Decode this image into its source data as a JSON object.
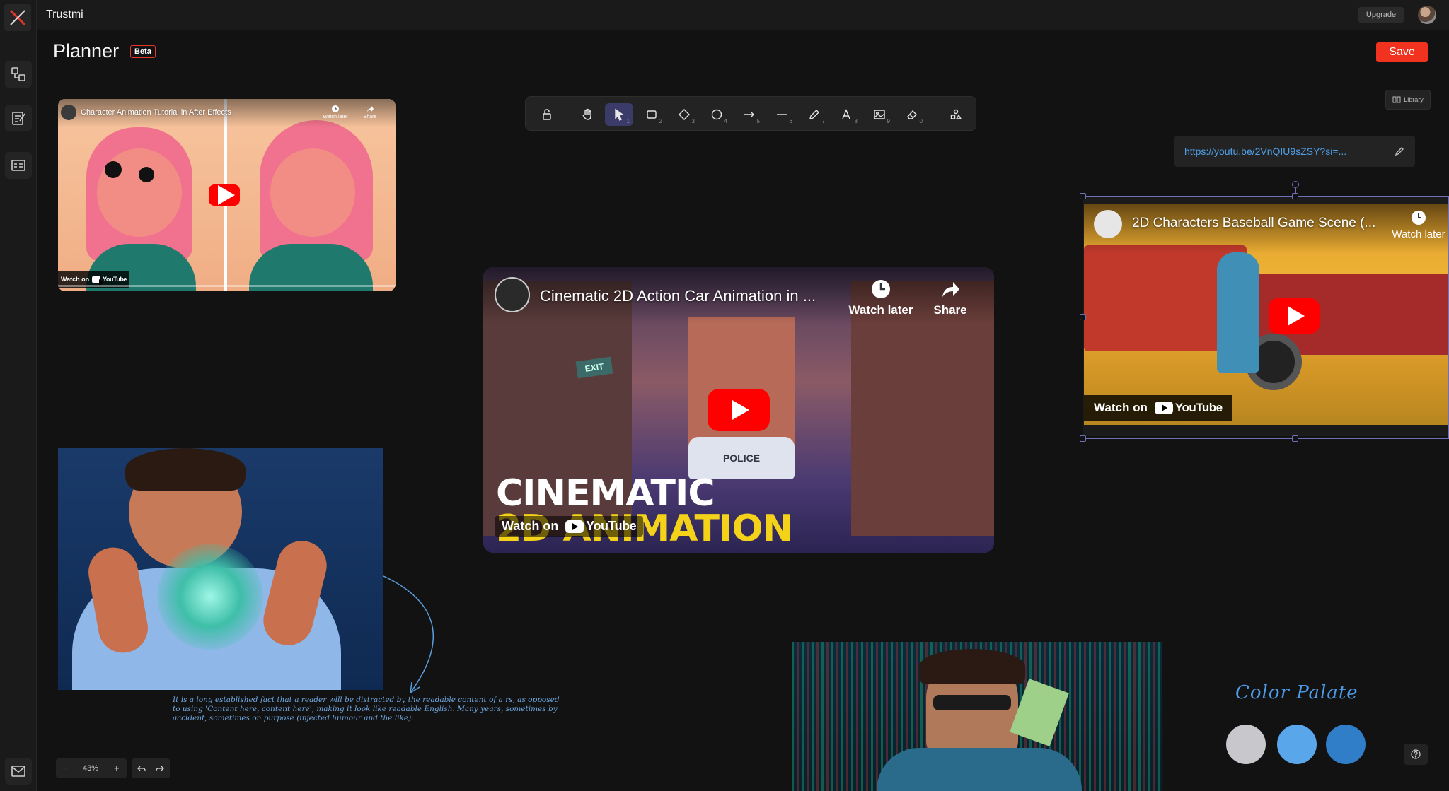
{
  "app": {
    "name": "Trustmi",
    "upgrade_label": "Upgrade"
  },
  "sidebar": {
    "items": [
      {
        "icon": "flow-icon"
      },
      {
        "icon": "notes-icon"
      },
      {
        "icon": "board-icon"
      },
      {
        "icon": "mail-icon"
      }
    ]
  },
  "header": {
    "title": "Planner",
    "badge": "Beta",
    "save_label": "Save"
  },
  "toolbar": {
    "tools": [
      {
        "icon": "lock-icon",
        "num": ""
      },
      {
        "icon": "hand-icon",
        "num": ""
      },
      {
        "icon": "pointer-icon",
        "num": "1",
        "active": true
      },
      {
        "icon": "rectangle-icon",
        "num": "2"
      },
      {
        "icon": "diamond-icon",
        "num": "3"
      },
      {
        "icon": "circle-icon",
        "num": "4"
      },
      {
        "icon": "arrow-icon",
        "num": "5"
      },
      {
        "icon": "line-icon",
        "num": "6"
      },
      {
        "icon": "pencil-icon",
        "num": "7"
      },
      {
        "icon": "text-icon",
        "num": "8"
      },
      {
        "icon": "image-icon",
        "num": "9"
      },
      {
        "icon": "eraser-icon",
        "num": "0"
      },
      {
        "icon": "shapes-icon",
        "num": ""
      }
    ]
  },
  "library_label": "Library",
  "url_bar": {
    "value": "https://youtu.be/2VnQIU9sZSY?si=..."
  },
  "videos": {
    "v1": {
      "title": "Character Animation Tutorial in After Effects",
      "watch_later": "Watch later",
      "share": "Share",
      "watch_on": "Watch on",
      "youtube": "YouTube"
    },
    "v2": {
      "title": "Cinematic 2D Action Car Animation in ...",
      "watch_later": "Watch later",
      "share": "Share",
      "watch_on": "Watch on",
      "youtube": "YouTube",
      "overlay_line1": "CINEMATIC",
      "overlay_line2": "2D ANIMATION",
      "sign_exit": "EXIT",
      "police": "POLICE"
    },
    "v3": {
      "title": "2D Characters Baseball Game Scene (...",
      "watch_later": "Watch later",
      "watch_on": "Watch on",
      "youtube": "YouTube"
    }
  },
  "annotation": {
    "text": "It is a long established fact that a reader will be distracted by the readable content of a rs, as opposed to using 'Content here, content here', making it look like readable English. Many years, sometimes by accident, sometimes on purpose (injected humour and the like)."
  },
  "palette": {
    "title": "Color Palate",
    "colors": [
      "#c8c8cc",
      "#5aa6ea",
      "#2f7ec7"
    ]
  },
  "canvas_controls": {
    "zoom": "43%",
    "minus": "−",
    "plus": "+"
  },
  "colors": {
    "accent": "#f0321f",
    "selection": "#7070b8",
    "link": "#4f9fe8"
  }
}
